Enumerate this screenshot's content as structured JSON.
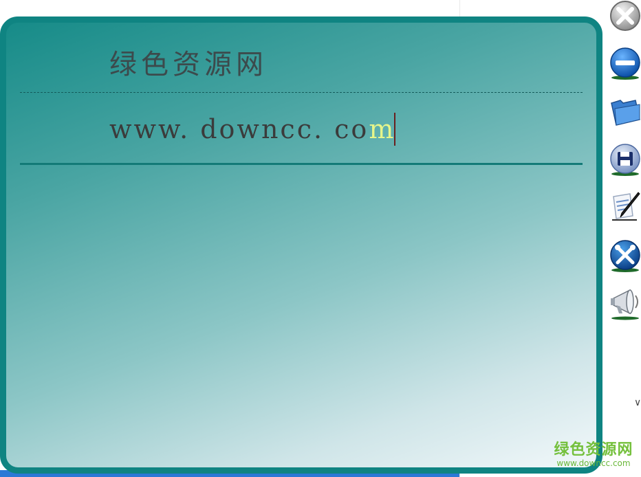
{
  "note": {
    "title": "绿色资源网",
    "url_text": "www. downcc. co",
    "url_last_char": "m"
  },
  "toolbar": {
    "items": [
      {
        "name": "close",
        "icon": "close-icon"
      },
      {
        "name": "minimize",
        "icon": "minimize-icon"
      },
      {
        "name": "open",
        "icon": "folder-icon"
      },
      {
        "name": "save",
        "icon": "save-icon"
      },
      {
        "name": "edit",
        "icon": "pen-paper-icon"
      },
      {
        "name": "settings",
        "icon": "tools-icon"
      },
      {
        "name": "announce",
        "icon": "megaphone-icon"
      }
    ]
  },
  "watermark": {
    "cn": "绿色资源网",
    "url": "www.downcc.com"
  },
  "colors": {
    "frame": "#0f8482",
    "gradient_start": "#168b88",
    "gradient_end": "#f2f8fa",
    "title_text": "#3c4a4c",
    "highlight_char": "#e6f58a",
    "caret": "#6a1e1e",
    "watermark": "#74c03c"
  }
}
